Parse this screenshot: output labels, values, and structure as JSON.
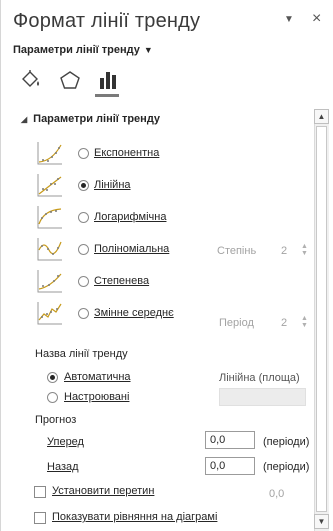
{
  "pane": {
    "title": "Формат лінії тренду",
    "menu_glyph": "▼",
    "close_glyph": "×",
    "options_dropdown_label": "Параметри лінії тренду",
    "options_dropdown_caret": "▼"
  },
  "categories": [
    {
      "name": "fill-line",
      "icon": "paint-bucket-icon"
    },
    {
      "name": "effects",
      "icon": "pentagon-icon"
    },
    {
      "name": "trendline-options",
      "icon": "bar-chart-icon",
      "selected": true
    }
  ],
  "section": {
    "expander": "◢",
    "title": "Параметри лінії тренду"
  },
  "trend_types": [
    {
      "label": "Експонентна",
      "selected": false,
      "icon": "exponential-trend-icon"
    },
    {
      "label": "Лінійна",
      "selected": true,
      "icon": "linear-trend-icon"
    },
    {
      "label": "Логарифмічна",
      "selected": false,
      "icon": "logarithmic-trend-icon"
    },
    {
      "label": "Поліноміальна",
      "selected": false,
      "icon": "polynomial-trend-icon"
    },
    {
      "label": "Степенева",
      "selected": false,
      "icon": "power-trend-icon"
    },
    {
      "label": "Змінне середнє",
      "selected": false,
      "icon": "moving-average-trend-icon"
    }
  ],
  "polynomial": {
    "label": "Степінь",
    "value": "2"
  },
  "moving_average": {
    "label": "Період",
    "value": "2"
  },
  "trend_name": {
    "heading": "Назва лінії тренду",
    "automatic_label": "Автоматична",
    "automatic_selected": true,
    "automatic_value": "Лінійна (площа)",
    "custom_label": "Настроювані",
    "custom_selected": false
  },
  "forecast": {
    "heading": "Прогноз",
    "forward_label": "Уперед",
    "forward_value": "0,0",
    "backward_label": "Назад",
    "backward_value": "0,0",
    "unit": "(періоди)"
  },
  "set_intercept": {
    "label": "Установити перетин",
    "checked": false,
    "value": "0,0"
  },
  "show_equation": {
    "label": "Показувати рівняння на діаграмі",
    "checked": false
  },
  "scrollbar": {
    "up": "▲",
    "down": "▼"
  }
}
